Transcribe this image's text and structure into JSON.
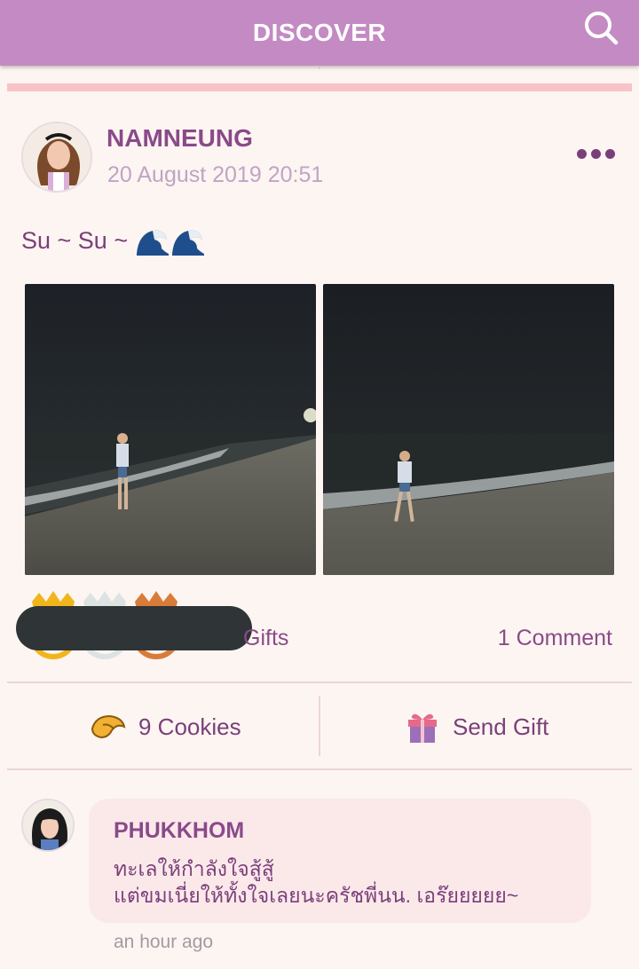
{
  "header": {
    "title": "DISCOVER",
    "search_icon": "search-icon"
  },
  "post": {
    "author": "NAMNEUNG",
    "timestamp": "20 August 2019 20:51",
    "caption": "Su ~ Su ~",
    "caption_emoji": "wave-emoji x2",
    "photos": [
      "beach-night-photo-1",
      "beach-night-photo-2"
    ],
    "gifts_label": "Gifts",
    "comments_label": "1 Comment",
    "crowns": [
      "gold",
      "silver",
      "bronze"
    ]
  },
  "actions": {
    "cookies_label": "9 Cookies",
    "send_gift_label": "Send Gift"
  },
  "comment": {
    "author": "PHUKKHOM",
    "text": "ทะเลให้กำลังใจสู้สู้\nแต่ขมเนี่ยให้ทั้งใจเลยนะครัชพี่นน. เอร๊ยยยยย~",
    "time": "an hour ago"
  },
  "colors": {
    "header": "#c48ac4",
    "accent": "#7a3f7a",
    "pink_strip": "#f7c3c8",
    "background": "#fdf5f1"
  }
}
